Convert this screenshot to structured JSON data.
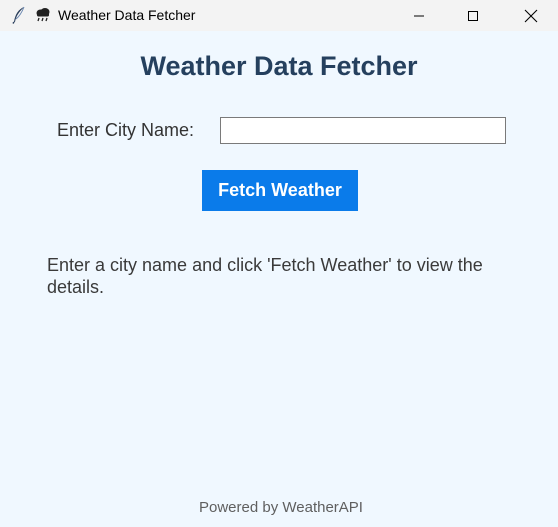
{
  "window": {
    "title": "Weather Data Fetcher",
    "app_icon": "feather-icon",
    "weather_icon": "rain-cloud-icon",
    "controls": [
      "minimize-icon",
      "maximize-icon",
      "close-icon"
    ]
  },
  "main": {
    "heading": "Weather Data Fetcher",
    "city_label": "Enter City Name:",
    "city_input_value": "",
    "fetch_button_label": "Fetch Weather",
    "result_text": "Enter a city name and click 'Fetch Weather' to view the details.",
    "footer_text": "Powered by WeatherAPI"
  },
  "colors": {
    "background": "#f0f8ff",
    "heading": "#25405e",
    "button": "#0a7bea",
    "button_text": "#ffffff"
  }
}
